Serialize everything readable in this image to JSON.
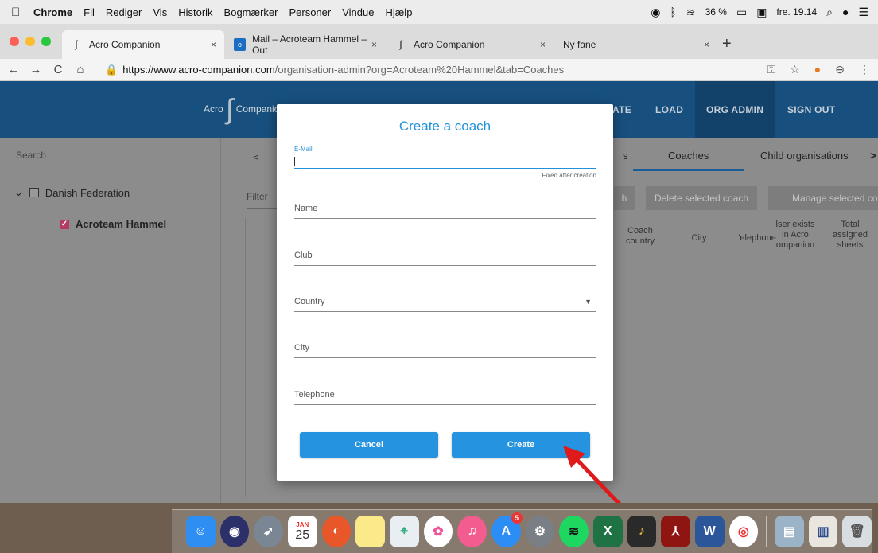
{
  "menubar": {
    "apple": "",
    "items": [
      "Chrome",
      "Fil",
      "Rediger",
      "Vis",
      "Historik",
      "Bogmærker",
      "Personer",
      "Vindue",
      "Hjælp"
    ],
    "battery": "36 %",
    "datetime": "fre. 19.14"
  },
  "tabs": [
    {
      "title": "Acro Companion",
      "close": "×"
    },
    {
      "title": "Mail – Acroteam Hammel – Out",
      "close": "×"
    },
    {
      "title": "Acro Companion",
      "close": "×"
    },
    {
      "title": "Ny fane",
      "close": "×"
    }
  ],
  "newtab": "+",
  "address": {
    "host": "https://www.acro-companion.com",
    "path": "/organisation-admin?org=Acroteam%20Hammel&tab=Coaches"
  },
  "topnav": {
    "logo_left": "Acro",
    "logo_right": "Companion",
    "items": [
      "ATE",
      "LOAD",
      "ORG ADMIN",
      "SIGN OUT"
    ]
  },
  "sidebar": {
    "search_placeholder": "Search",
    "collapse": "<",
    "tree": [
      {
        "label": "Danish Federation"
      },
      {
        "label": "Acroteam Hammel"
      }
    ]
  },
  "main": {
    "tab_prev": "<",
    "tab_partial": "s",
    "tabs": [
      "Coaches",
      "Child organisations"
    ],
    "tab_next": ">",
    "filter_placeholder": "Filter",
    "buttons": [
      "h",
      "Delete selected coach",
      "Manage selected co"
    ],
    "columns": [
      "Coach\ncountry",
      "City",
      "'elephone",
      "lser exists\nin Acro\nompanion",
      "Total\nassigned\nsheets"
    ]
  },
  "modal": {
    "title": "Create a coach",
    "email_label": "E-Mail",
    "email_hint": "Fixed after creation",
    "fields": [
      "Name",
      "Club",
      "Country",
      "City",
      "Telephone"
    ],
    "cancel": "Cancel",
    "create": "Create"
  },
  "dock": {
    "calendar_month": "JAN",
    "calendar_day": "25",
    "appstore_badge": "5",
    "excel_label": "X",
    "word_label": "W"
  }
}
